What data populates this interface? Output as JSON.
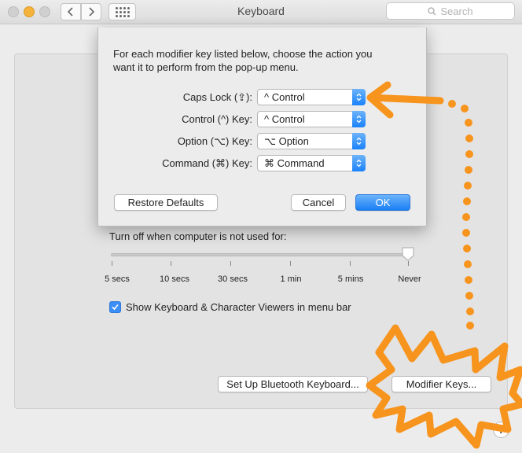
{
  "window": {
    "title": "Keyboard"
  },
  "search": {
    "placeholder": "Search"
  },
  "sheet": {
    "description_line1": "For each modifier key listed below, choose the action you",
    "description_line2": "want it to perform from the pop-up menu.",
    "rows": [
      {
        "label": "Caps Lock (⇪):",
        "value": "^ Control"
      },
      {
        "label": "Control (^) Key:",
        "value": "^ Control"
      },
      {
        "label": "Option (⌥) Key:",
        "value": "⌥ Option"
      },
      {
        "label": "Command (⌘) Key:",
        "value": "⌘ Command"
      }
    ],
    "restore_label": "Restore Defaults",
    "cancel_label": "Cancel",
    "ok_label": "OK"
  },
  "pane": {
    "turnoff_label": "Turn off when computer is not used for:",
    "slider_ticks": [
      "5 secs",
      "10 secs",
      "30 secs",
      "1 min",
      "5 mins",
      "Never"
    ],
    "slider_value": "Never",
    "show_viewers_label": "Show Keyboard & Character Viewers in menu bar",
    "show_viewers_checked": true,
    "bluetooth_label": "Set Up Bluetooth Keyboard...",
    "modifier_label": "Modifier Keys...",
    "help_label": "?"
  },
  "colors": {
    "accent": "#1a82fb",
    "annotation": "#f7941d"
  },
  "icons": [
    "back-chevron-icon",
    "forward-chevron-icon",
    "grid-icon",
    "search-icon",
    "checkmark-icon",
    "popup-arrows-icon"
  ]
}
